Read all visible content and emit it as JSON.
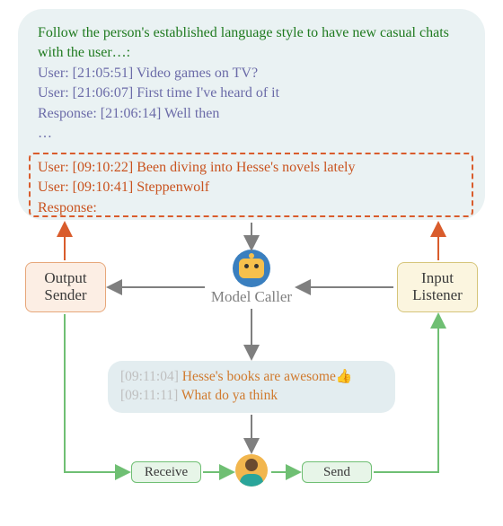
{
  "prompt": {
    "instruction": "Follow the person's established language style to have new casual chats with the user…:",
    "examples": [
      "User: [21:05:51] Video games on TV?",
      "User: [21:06:07] First time I've heard of it",
      "Response: [21:06:14] Well then"
    ],
    "ellipsis": "…",
    "new_turn": [
      "User: [09:10:22] Been diving into Hesse's novels lately",
      "User: [09:10:41] Steppenwolf",
      "Response:"
    ]
  },
  "nodes": {
    "output_sender": "Output Sender",
    "model_caller": "Model Caller",
    "input_listener": "Input Listener"
  },
  "reply": {
    "line1_ts": "[09:11:04]",
    "line1_text": "Hesse's books are awesome",
    "line1_emoji": "👍",
    "line2_ts": "[09:11:11]",
    "line2_text": "What do ya think"
  },
  "flow": {
    "receive": "Receive",
    "send": "Send"
  },
  "colors": {
    "instruction": "#1f7a1f",
    "example": "#6b6ba8",
    "new_turn": "#c9531f",
    "arrow_red": "#d95c2c",
    "arrow_gray": "#7f7f7f",
    "arrow_green": "#6fbf73"
  }
}
